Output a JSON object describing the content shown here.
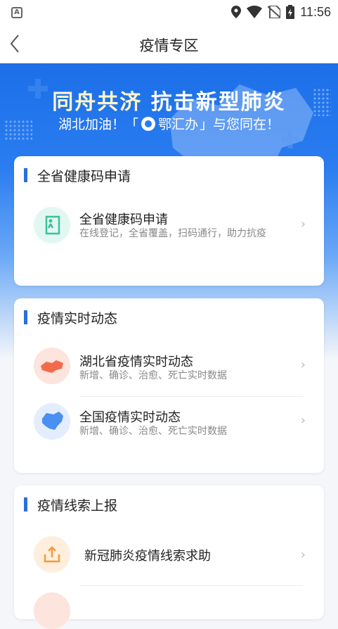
{
  "status_bar": {
    "time": "11:56",
    "notif_icon": "A"
  },
  "header": {
    "title": "疫情专区"
  },
  "banner": {
    "headline_part1": "同舟共济",
    "headline_part2": "抗击新型肺炎",
    "sub_before": "湖北加油！「",
    "sub_brand": "鄂汇办",
    "sub_after": "」与您同在！"
  },
  "sections": {
    "health_code": {
      "title": "全省健康码申请",
      "item_name": "全省健康码申请",
      "item_desc": "在线登记，全省覆盖，扫码通行，助力抗疫"
    },
    "live": {
      "title": "疫情实时动态",
      "items": [
        {
          "name": "湖北省疫情实时动态",
          "desc": "新增、确诊、治愈、死亡实时数据"
        },
        {
          "name": "全国疫情实时动态",
          "desc": "新增、确诊、治愈、死亡实时数据"
        }
      ]
    },
    "report": {
      "title": "疫情线索上报",
      "items": [
        {
          "name": "新冠肺炎疫情线索求助"
        }
      ]
    }
  },
  "colors": {
    "accent": "#2b6fdc",
    "banner_blue": "#1d6fe8"
  }
}
